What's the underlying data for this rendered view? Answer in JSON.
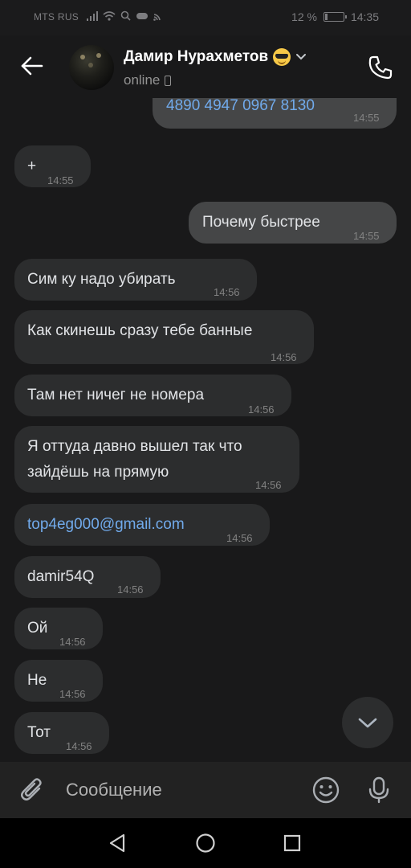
{
  "status_bar": {
    "carrier": "MTS RUS",
    "battery": "12 %",
    "battery_level": 0.12,
    "time": "14:35"
  },
  "header": {
    "contact_name": "Дамир Нурахметов",
    "presence": "online",
    "icons": [
      "back-arrow-icon",
      "avatar",
      "sunglasses-emoji-icon",
      "chevron-down-icon",
      "mobile-device-icon",
      "phone-call-icon"
    ]
  },
  "messages": [
    {
      "dir": "out",
      "text": "4890 4947 0967 8130",
      "time": "14:55",
      "link": true
    },
    {
      "dir": "in",
      "text": "+",
      "time": "14:55"
    },
    {
      "dir": "out",
      "text": "Почему быстрее",
      "time": "14:55"
    },
    {
      "dir": "in",
      "text": "Сим ку надо убирать",
      "time": "14:56"
    },
    {
      "dir": "in",
      "text": "Как скинешь сразу тебе банные",
      "time": "14:56"
    },
    {
      "dir": "in",
      "text": "Там нет ничег не номера",
      "time": "14:56"
    },
    {
      "dir": "in",
      "text_line1": "Я оттуда давно вышел так что",
      "text_line2": "зайдёшь на прямую",
      "time": "14:56"
    },
    {
      "dir": "in",
      "text": "top4eg000@gmail.com",
      "time": "14:56",
      "link": true
    },
    {
      "dir": "in",
      "text": "damir54Q",
      "time": "14:56"
    },
    {
      "dir": "in",
      "text": "Ой",
      "time": "14:56"
    },
    {
      "dir": "in",
      "text": "Не",
      "time": "14:56"
    },
    {
      "dir": "in",
      "text": "Тот",
      "time": "14:56"
    }
  ],
  "composer": {
    "placeholder": "Сообщение",
    "icons": [
      "attach-icon",
      "emoji-icon",
      "microphone-icon"
    ]
  },
  "colors": {
    "background": "#19191a",
    "incoming_bubble": "#2c2d2e",
    "outgoing_bubble": "#454647",
    "link": "#71aaeb",
    "time": "#828282"
  }
}
